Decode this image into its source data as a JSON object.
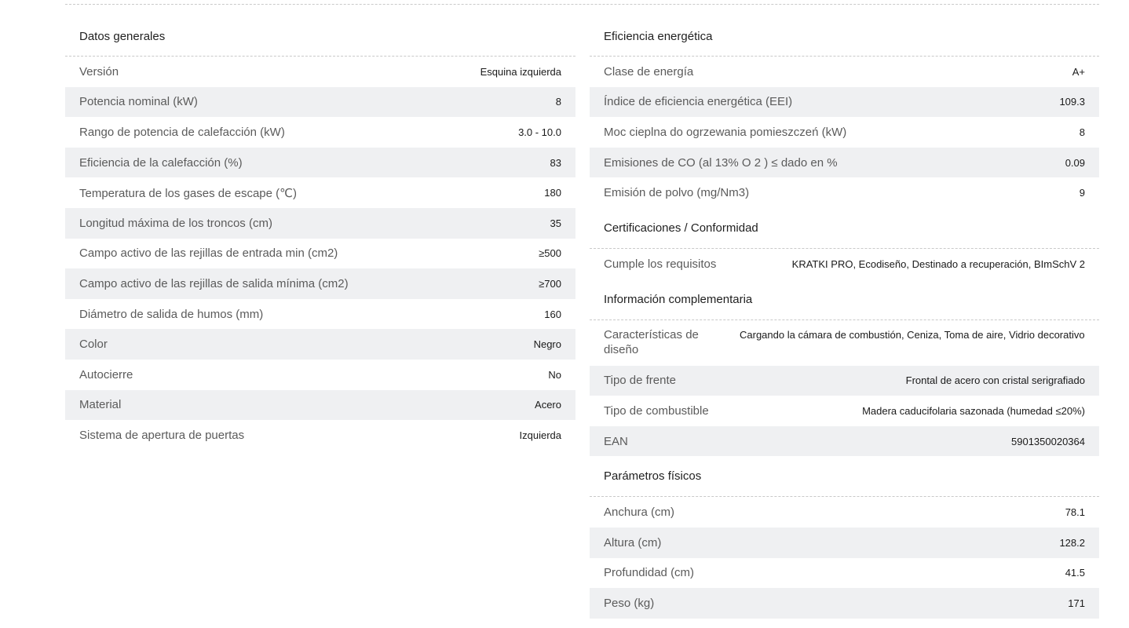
{
  "general": {
    "title": "Datos generales",
    "rows": [
      {
        "label": "Versión",
        "value": "Esquina izquierda"
      },
      {
        "label": "Potencia nominal (kW)",
        "value": "8"
      },
      {
        "label": "Rango de potencia de calefacción (kW)",
        "value": "3.0 - 10.0"
      },
      {
        "label": "Eficiencia de la calefacción (%)",
        "value": "83"
      },
      {
        "label": "Temperatura de los gases de escape (℃)",
        "value": "180"
      },
      {
        "label": "Longitud máxima de los troncos (cm)",
        "value": "35"
      },
      {
        "label": "Campo activo de las rejillas de entrada min (cm2)",
        "value": "≥500"
      },
      {
        "label": "Campo activo de las rejillas de salida mínima (cm2)",
        "value": "≥700"
      },
      {
        "label": "Diámetro de salida de humos (mm)",
        "value": "160"
      },
      {
        "label": "Color",
        "value": "Negro"
      },
      {
        "label": "Autocierre",
        "value": "No"
      },
      {
        "label": "Material",
        "value": "Acero"
      },
      {
        "label": "Sistema de apertura de puertas",
        "value": "Izquierda"
      }
    ]
  },
  "efficiency": {
    "title": "Eficiencia energética",
    "rows": [
      {
        "label": "Clase de energía",
        "value": "A+"
      },
      {
        "label": "Índice de eficiencia energética (EEI)",
        "value": "109.3"
      },
      {
        "label": "Moc cieplna do ogrzewania pomieszczeń (kW)",
        "value": "8"
      },
      {
        "label": "Emisiones de CO (al 13% O 2 ) ≤ dado en %",
        "value": "0.09"
      },
      {
        "label": "Emisión de polvo (mg/Nm3)",
        "value": "9"
      }
    ]
  },
  "certifications": {
    "title": "Certificaciones / Conformidad",
    "rows": [
      {
        "label": "Cumple los requisitos",
        "value": "KRATKI PRO, Ecodiseño, Destinado a recuperación, BImSchV 2"
      }
    ]
  },
  "complementary": {
    "title": "Información complementaria",
    "rows": [
      {
        "label": "Características de diseño",
        "value": "Cargando la cámara de combustión, Ceniza, Toma de aire, Vidrio decorativo"
      },
      {
        "label": "Tipo de frente",
        "value": "Frontal de acero con cristal serigrafiado"
      },
      {
        "label": "Tipo de combustible",
        "value": "Madera caducifolaria sazonada (humedad ≤20%)"
      },
      {
        "label": "EAN",
        "value": "5901350020364"
      }
    ]
  },
  "physical": {
    "title": "Parámetros físicos",
    "rows": [
      {
        "label": "Anchura (cm)",
        "value": "78.1"
      },
      {
        "label": "Altura (cm)",
        "value": "128.2"
      },
      {
        "label": "Profundidad (cm)",
        "value": "41.5"
      },
      {
        "label": "Peso (kg)",
        "value": "171"
      }
    ]
  }
}
